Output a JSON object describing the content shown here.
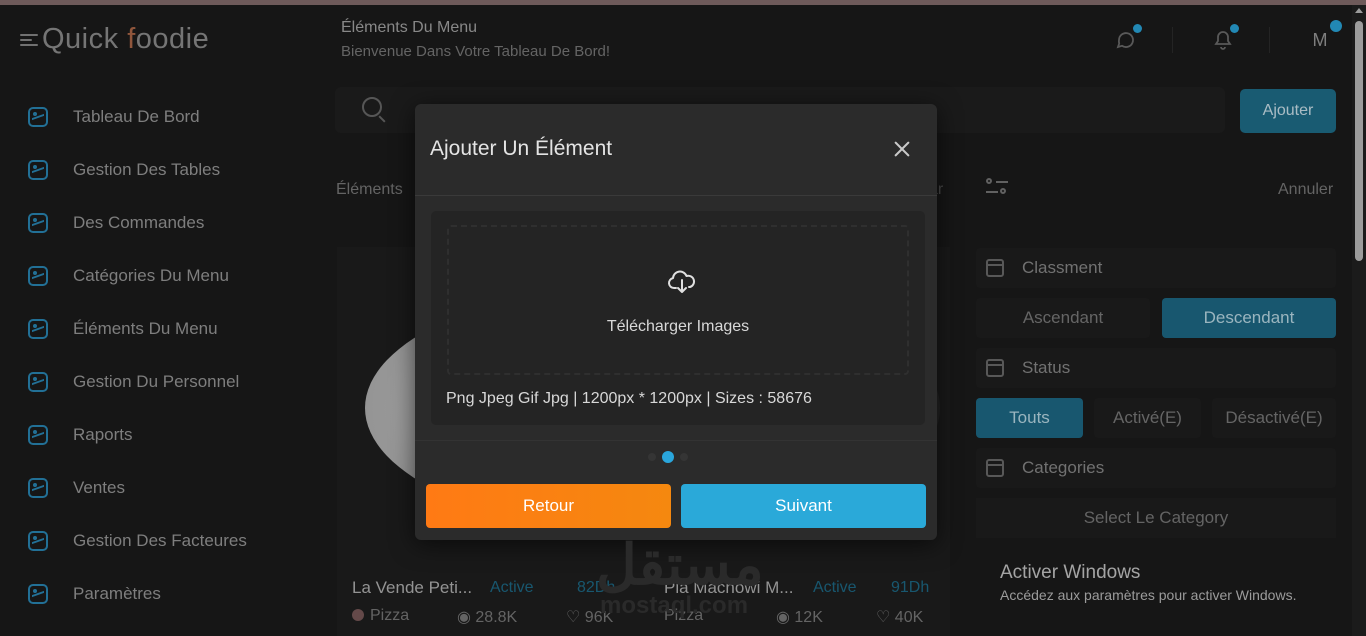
{
  "logo": {
    "text_a": "Quick ",
    "text_b": "f",
    "text_c": "oodie"
  },
  "sidebar": {
    "items": [
      {
        "label": "Tableau De Bord"
      },
      {
        "label": "Gestion Des Tables"
      },
      {
        "label": "Des Commandes"
      },
      {
        "label": "Catégories Du Menu"
      },
      {
        "label": "Éléments Du Menu"
      },
      {
        "label": "Gestion Du Personnel"
      },
      {
        "label": "Raports"
      },
      {
        "label": "Ventes"
      },
      {
        "label": "Gestion Des Facteures"
      },
      {
        "label": "Paramètres"
      }
    ]
  },
  "header": {
    "title": "Éléments Du Menu",
    "subtitle": "Bienvenue Dans Votre Tableau De Bord!",
    "avatar_initial": "M"
  },
  "toolbar": {
    "add_label": "Ajouter"
  },
  "tabs": {
    "elements_label": "Éléments",
    "right_fragment": "ar"
  },
  "filters": {
    "cancel_label": "Annuler",
    "sort_title": "Classment",
    "sort_options": [
      "Ascendant",
      "Descendant"
    ],
    "sort_selected": "Descendant",
    "status_title": "Status",
    "status_options": [
      "Touts",
      "Activé(E)",
      "Désactivé(E)"
    ],
    "status_selected": "Touts",
    "categories_title": "Categories",
    "category_placeholder": "Select Le Category"
  },
  "cards": [
    {
      "name": "La Vende Peti...",
      "status": "Active",
      "time": "82Dh",
      "category": "Pizza",
      "views": "28.8K",
      "likes": "96K"
    },
    {
      "name": "Pia Machowi M...",
      "status": "Active",
      "time": "91Dh",
      "category": "Pizza",
      "views": "12K",
      "likes": "40K"
    }
  ],
  "windows_activation": {
    "title": "Activer Windows",
    "subtitle": "Accédez aux paramètres pour activer Windows."
  },
  "watermark": {
    "arabic": "مستقل",
    "latin": "mostaql.com"
  },
  "modal": {
    "title": "Ajouter Un Élément",
    "upload_label": "Télécharger Images",
    "upload_info": "Png Jpeg Gif Jpg | 1200px * 1200px | Sizes : 58676",
    "pager": {
      "total": 3,
      "current": 2
    },
    "back_label": "Retour",
    "next_label": "Suivant"
  },
  "colors": {
    "accent": "#2aa9d9",
    "accent_dark": "#1e6b88",
    "orange": "#ff7a14",
    "background": "#1b1b1b",
    "modal_bg": "#2b2b2b"
  },
  "icons": {
    "menu": "hamburger-icon",
    "nav": "image-icon",
    "chat": "chat-icon",
    "bell": "bell-icon",
    "search": "search-icon",
    "filter": "sliders-icon",
    "calendar": "calendar-icon",
    "close": "close-icon",
    "upload": "cloud-upload-icon",
    "eye": "eye-icon",
    "heart": "heart-icon"
  }
}
